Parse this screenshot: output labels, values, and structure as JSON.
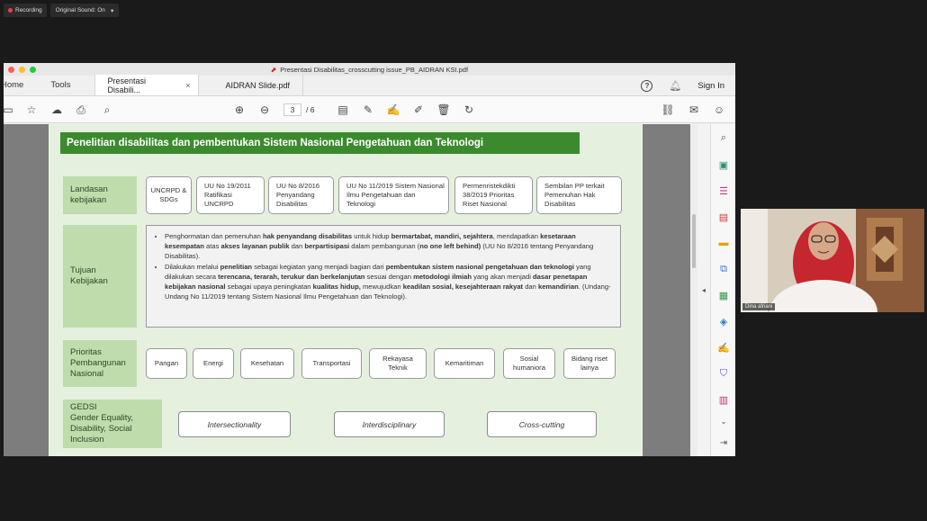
{
  "zoom": {
    "recording_label": "Recording",
    "sound_label": "Original Sound: On"
  },
  "window": {
    "title": "Presentasi Disabilitas_crosscutting issue_PB_AIDRAN KSI.pdf",
    "traffic_colors": [
      "#fe5f57",
      "#febc2e",
      "#28c840"
    ]
  },
  "tabs": {
    "home": "Home",
    "tools": "Tools",
    "doc_tabs": [
      {
        "label": "Presentasi Disabili...",
        "active": true
      },
      {
        "label": "AIDRAN Slide.pdf",
        "active": false
      }
    ],
    "help_glyph": "?",
    "sign_in": "Sign In"
  },
  "toolbar": {
    "current_page": "3",
    "total_pages": "/ 6"
  },
  "slide": {
    "title": "Penelitian disabilitas dan pembentukan Sistem Nasional Pengetahuan dan Teknologi",
    "rows": {
      "landasan": "Landasan kebijakan",
      "tujuan": "Tujuan Kebijakan",
      "prioritas": "Prioritas Pembangunan Nasional",
      "gedsi_line1": "GEDSI",
      "gedsi_line2": "Gender Equality, Disability, Social Inclusion"
    },
    "landasan_items": [
      "UNCRPD & SDGs",
      "UU No 19/2011 Ratifikasi UNCRPD",
      "UU No 8/2016 Penyandang Disabilitas",
      "UU No 11/2019 Sistem Nasional Ilmu Pengetahuan dan Teknologi",
      "Permenristekdikti 38/2019 Prioritas Riset Nasional",
      "Sembilan PP terkait Pemenuhan Hak Disabilitas"
    ],
    "tujuan_bullets": [
      [
        {
          "t": "Penghormatan dan pemenuhan ",
          "b": false
        },
        {
          "t": "hak penyandang disabilitas",
          "b": true
        },
        {
          "t": " untuk hidup ",
          "b": false
        },
        {
          "t": "bermartabat, mandiri, sejahtera",
          "b": true
        },
        {
          "t": ", mendapatkan ",
          "b": false
        },
        {
          "t": "kesetaraan kesempatan",
          "b": true
        },
        {
          "t": " atas ",
          "b": false
        },
        {
          "t": "akses layanan publik",
          "b": true
        },
        {
          "t": " dan ",
          "b": false
        },
        {
          "t": "berpartisipasi",
          "b": true
        },
        {
          "t": " dalam pembangunan (",
          "b": false
        },
        {
          "t": "no one left behind)",
          "b": true
        },
        {
          "t": " (UU No 8/2016 tentang Penyandang Disabilitas).",
          "b": false
        }
      ],
      [
        {
          "t": "Dilakukan melalui ",
          "b": false
        },
        {
          "t": "penelitian",
          "b": true
        },
        {
          "t": " sebagai kegiatan yang menjadi bagian dari ",
          "b": false
        },
        {
          "t": "pembentukan sistem nasional pengetahuan dan teknologi",
          "b": true
        },
        {
          "t": " yang dilakukan secara ",
          "b": false
        },
        {
          "t": "terencana, terarah, terukur dan berkelanjutan",
          "b": true
        },
        {
          "t": " sesuai dengan ",
          "b": false
        },
        {
          "t": "metodologi ilmiah",
          "b": true
        },
        {
          "t": " yang akan menjadi ",
          "b": false
        },
        {
          "t": "dasar penetapan kebijakan nasional",
          "b": true
        },
        {
          "t": " sebagai upaya peningkatan ",
          "b": false
        },
        {
          "t": "kualitas hidup,",
          "b": true
        },
        {
          "t": " mewujudkan ",
          "b": false
        },
        {
          "t": "keadilan sosial, kesejahteraan rakyat",
          "b": true
        },
        {
          "t": " dan ",
          "b": false
        },
        {
          "t": "kemandirian",
          "b": true
        },
        {
          "t": ". (Undang-Undang No 11/2019 tentang Sistem Nasional Ilmu Pengetahuan dan Teknologi).",
          "b": false
        }
      ]
    ],
    "prioritas_items": [
      "Pangan",
      "Energi",
      "Kesehatan",
      "Transportasi",
      "Rekayasa Teknik",
      "Kemaritiman",
      "Sosial humaniora",
      "Bidang riset lainya"
    ],
    "gedsi_items": [
      "Intersectionality",
      "Interdisciplinary",
      "Cross-cutting"
    ]
  },
  "webcam": {
    "name": "Dina afriani"
  }
}
